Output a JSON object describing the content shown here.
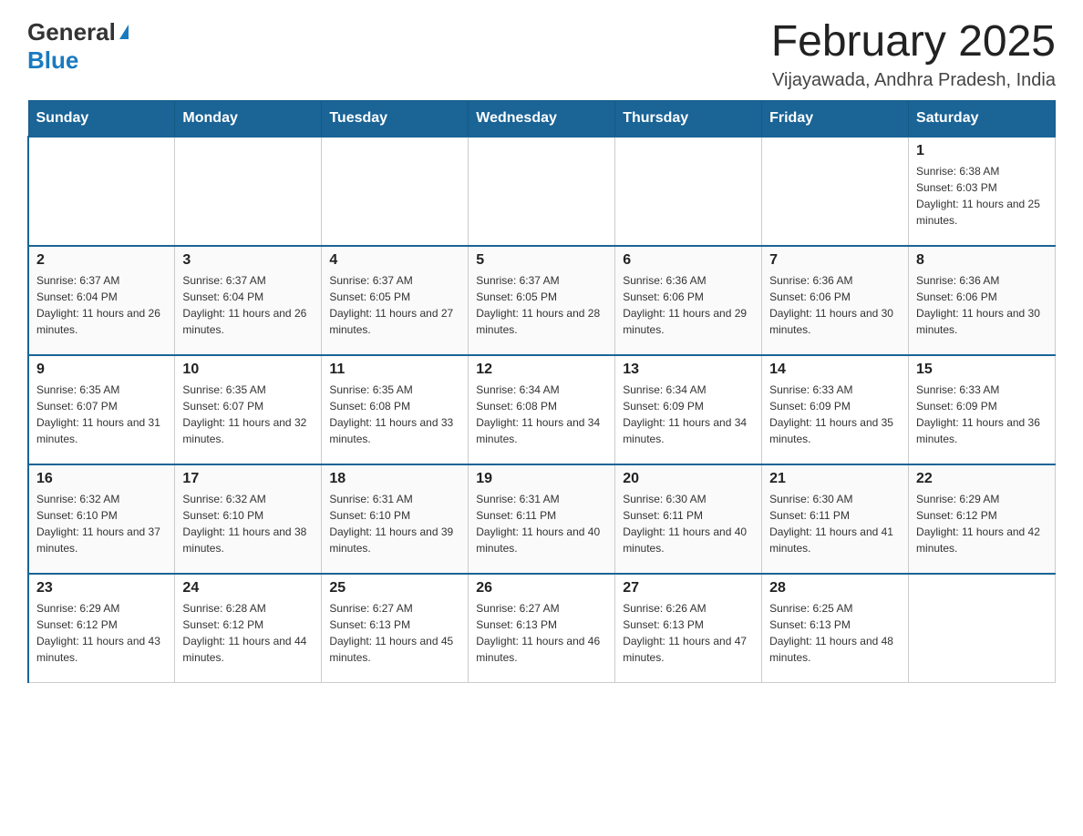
{
  "logo": {
    "general": "General",
    "blue": "Blue",
    "triangle": "▲"
  },
  "title": "February 2025",
  "location": "Vijayawada, Andhra Pradesh, India",
  "days_of_week": [
    "Sunday",
    "Monday",
    "Tuesday",
    "Wednesday",
    "Thursday",
    "Friday",
    "Saturday"
  ],
  "weeks": [
    [
      {
        "day": "",
        "info": ""
      },
      {
        "day": "",
        "info": ""
      },
      {
        "day": "",
        "info": ""
      },
      {
        "day": "",
        "info": ""
      },
      {
        "day": "",
        "info": ""
      },
      {
        "day": "",
        "info": ""
      },
      {
        "day": "1",
        "info": "Sunrise: 6:38 AM\nSunset: 6:03 PM\nDaylight: 11 hours and 25 minutes."
      }
    ],
    [
      {
        "day": "2",
        "info": "Sunrise: 6:37 AM\nSunset: 6:04 PM\nDaylight: 11 hours and 26 minutes."
      },
      {
        "day": "3",
        "info": "Sunrise: 6:37 AM\nSunset: 6:04 PM\nDaylight: 11 hours and 26 minutes."
      },
      {
        "day": "4",
        "info": "Sunrise: 6:37 AM\nSunset: 6:05 PM\nDaylight: 11 hours and 27 minutes."
      },
      {
        "day": "5",
        "info": "Sunrise: 6:37 AM\nSunset: 6:05 PM\nDaylight: 11 hours and 28 minutes."
      },
      {
        "day": "6",
        "info": "Sunrise: 6:36 AM\nSunset: 6:06 PM\nDaylight: 11 hours and 29 minutes."
      },
      {
        "day": "7",
        "info": "Sunrise: 6:36 AM\nSunset: 6:06 PM\nDaylight: 11 hours and 30 minutes."
      },
      {
        "day": "8",
        "info": "Sunrise: 6:36 AM\nSunset: 6:06 PM\nDaylight: 11 hours and 30 minutes."
      }
    ],
    [
      {
        "day": "9",
        "info": "Sunrise: 6:35 AM\nSunset: 6:07 PM\nDaylight: 11 hours and 31 minutes."
      },
      {
        "day": "10",
        "info": "Sunrise: 6:35 AM\nSunset: 6:07 PM\nDaylight: 11 hours and 32 minutes."
      },
      {
        "day": "11",
        "info": "Sunrise: 6:35 AM\nSunset: 6:08 PM\nDaylight: 11 hours and 33 minutes."
      },
      {
        "day": "12",
        "info": "Sunrise: 6:34 AM\nSunset: 6:08 PM\nDaylight: 11 hours and 34 minutes."
      },
      {
        "day": "13",
        "info": "Sunrise: 6:34 AM\nSunset: 6:09 PM\nDaylight: 11 hours and 34 minutes."
      },
      {
        "day": "14",
        "info": "Sunrise: 6:33 AM\nSunset: 6:09 PM\nDaylight: 11 hours and 35 minutes."
      },
      {
        "day": "15",
        "info": "Sunrise: 6:33 AM\nSunset: 6:09 PM\nDaylight: 11 hours and 36 minutes."
      }
    ],
    [
      {
        "day": "16",
        "info": "Sunrise: 6:32 AM\nSunset: 6:10 PM\nDaylight: 11 hours and 37 minutes."
      },
      {
        "day": "17",
        "info": "Sunrise: 6:32 AM\nSunset: 6:10 PM\nDaylight: 11 hours and 38 minutes."
      },
      {
        "day": "18",
        "info": "Sunrise: 6:31 AM\nSunset: 6:10 PM\nDaylight: 11 hours and 39 minutes."
      },
      {
        "day": "19",
        "info": "Sunrise: 6:31 AM\nSunset: 6:11 PM\nDaylight: 11 hours and 40 minutes."
      },
      {
        "day": "20",
        "info": "Sunrise: 6:30 AM\nSunset: 6:11 PM\nDaylight: 11 hours and 40 minutes."
      },
      {
        "day": "21",
        "info": "Sunrise: 6:30 AM\nSunset: 6:11 PM\nDaylight: 11 hours and 41 minutes."
      },
      {
        "day": "22",
        "info": "Sunrise: 6:29 AM\nSunset: 6:12 PM\nDaylight: 11 hours and 42 minutes."
      }
    ],
    [
      {
        "day": "23",
        "info": "Sunrise: 6:29 AM\nSunset: 6:12 PM\nDaylight: 11 hours and 43 minutes."
      },
      {
        "day": "24",
        "info": "Sunrise: 6:28 AM\nSunset: 6:12 PM\nDaylight: 11 hours and 44 minutes."
      },
      {
        "day": "25",
        "info": "Sunrise: 6:27 AM\nSunset: 6:13 PM\nDaylight: 11 hours and 45 minutes."
      },
      {
        "day": "26",
        "info": "Sunrise: 6:27 AM\nSunset: 6:13 PM\nDaylight: 11 hours and 46 minutes."
      },
      {
        "day": "27",
        "info": "Sunrise: 6:26 AM\nSunset: 6:13 PM\nDaylight: 11 hours and 47 minutes."
      },
      {
        "day": "28",
        "info": "Sunrise: 6:25 AM\nSunset: 6:13 PM\nDaylight: 11 hours and 48 minutes."
      },
      {
        "day": "",
        "info": ""
      }
    ]
  ]
}
